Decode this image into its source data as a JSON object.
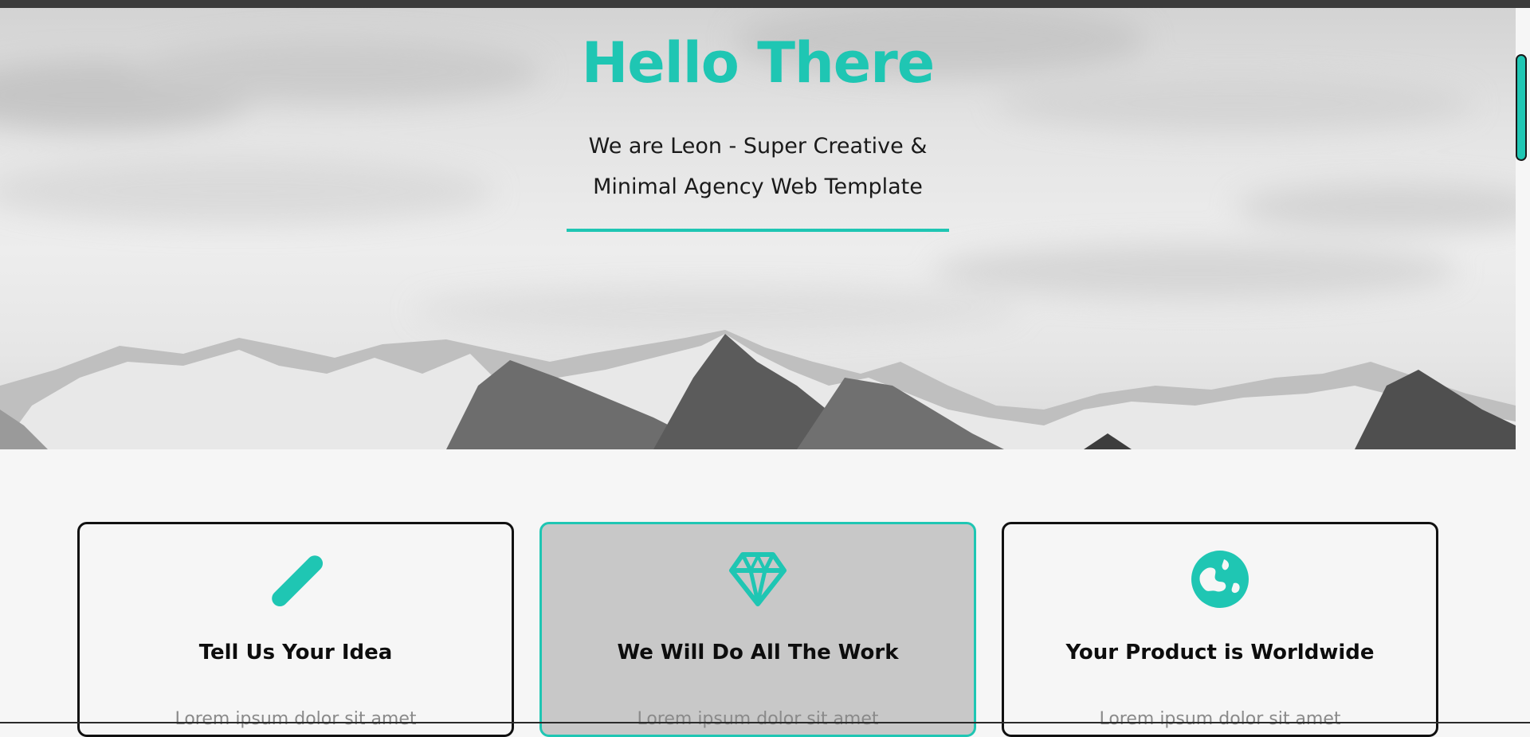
{
  "hero": {
    "title": "Hello There",
    "subtitle_line1": "We are Leon - Super Creative &",
    "subtitle_line2": "Minimal Agency Web Template"
  },
  "colors": {
    "accent": "#1fc6b3",
    "featured_card_bg": "#c8c8c8"
  },
  "features": [
    {
      "icon": "pencil-icon",
      "title": "Tell Us Your Idea",
      "text": "Lorem ipsum dolor sit amet"
    },
    {
      "icon": "diamond-icon",
      "title": "We Will Do All The Work",
      "text": "Lorem ipsum dolor sit amet"
    },
    {
      "icon": "globe-icon",
      "title": "Your Product is Worldwide",
      "text": "Lorem ipsum dolor sit amet"
    }
  ]
}
